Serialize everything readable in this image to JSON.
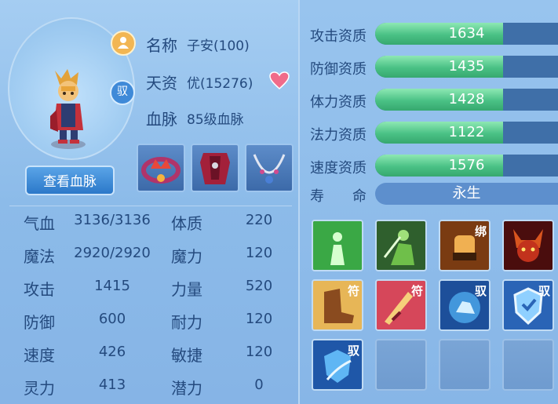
{
  "profile": {
    "name_label": "名称",
    "name_value": "子安(100)",
    "talent_label": "天资",
    "talent_value": "优(15276)",
    "bloodline_label": "血脉",
    "bloodline_value": "85级血脉",
    "view_bloodline_button": "查看血脉",
    "monk_badge_icon": "monk-badge-icon",
    "yu_badge_text": "驭",
    "favorite_icon": "heart-icon"
  },
  "stats_left": [
    {
      "label": "气血",
      "value": "3136/3136"
    },
    {
      "label": "魔法",
      "value": "2920/2920"
    },
    {
      "label": "攻击",
      "value": "1415"
    },
    {
      "label": "防御",
      "value": "600"
    },
    {
      "label": "速度",
      "value": "426"
    },
    {
      "label": "灵力",
      "value": "413"
    }
  ],
  "stats_right": [
    {
      "label": "体质",
      "value": "220"
    },
    {
      "label": "魔力",
      "value": "120"
    },
    {
      "label": "力量",
      "value": "520"
    },
    {
      "label": "耐力",
      "value": "120"
    },
    {
      "label": "敏捷",
      "value": "120"
    },
    {
      "label": "潜力",
      "value": "0"
    }
  ],
  "aptitudes": [
    {
      "label": "攻击资质",
      "value": "1634",
      "fill": 0.7
    },
    {
      "label": "防御资质",
      "value": "1435",
      "fill": 0.7
    },
    {
      "label": "体力资质",
      "value": "1428",
      "fill": 0.7
    },
    {
      "label": "法力资质",
      "value": "1122",
      "fill": 0.7
    },
    {
      "label": "速度资质",
      "value": "1576",
      "fill": 0.7
    }
  ],
  "lifespan": {
    "label": "寿　　命",
    "value": "永生"
  },
  "equipment": [
    "crown-ring-icon",
    "armor-icon",
    "necklace-icon"
  ],
  "skills": [
    {
      "icon": "green-aura-icon",
      "tag": ""
    },
    {
      "icon": "green-warrior-icon",
      "tag": ""
    },
    {
      "icon": "fist-bind-icon",
      "tag": "绑"
    },
    {
      "icon": "demon-head-icon",
      "tag": ""
    },
    {
      "icon": "boot-talisman-icon",
      "tag": "符"
    },
    {
      "icon": "sword-talisman-icon",
      "tag": "符"
    },
    {
      "icon": "beast-orb-icon",
      "tag": "驭"
    },
    {
      "icon": "shield-icon",
      "tag": "驭"
    },
    {
      "icon": "blue-shield-icon",
      "tag": "驭"
    },
    {
      "icon": "empty-slot",
      "tag": ""
    },
    {
      "icon": "empty-slot",
      "tag": ""
    },
    {
      "icon": "empty-slot",
      "tag": ""
    }
  ],
  "colors": {
    "accent": "#36a86f",
    "text": "#244a7e",
    "button": "#2b78c9"
  }
}
